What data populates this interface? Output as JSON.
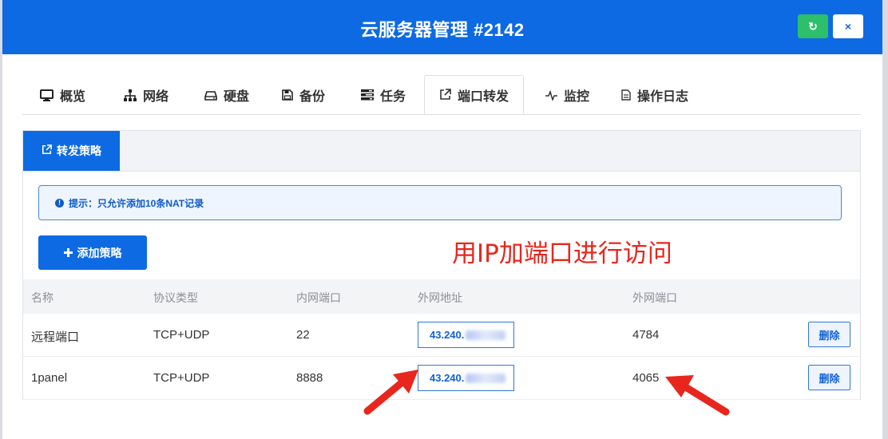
{
  "header": {
    "title": "云服务器管理 #2142",
    "refresh_icon": "refresh-icon",
    "close_icon": "close-icon",
    "close_glyph": "×",
    "refresh_glyph": "↻"
  },
  "tabs": [
    {
      "label": "概览",
      "icon": "monitor-icon"
    },
    {
      "label": "网络",
      "icon": "network-icon"
    },
    {
      "label": "硬盘",
      "icon": "disk-icon"
    },
    {
      "label": "备份",
      "icon": "save-icon"
    },
    {
      "label": "任务",
      "icon": "tasks-icon"
    },
    {
      "label": "端口转发",
      "icon": "external-link-icon",
      "active": true
    },
    {
      "label": "监控",
      "icon": "pulse-icon"
    },
    {
      "label": "操作日志",
      "icon": "file-icon"
    }
  ],
  "subtab": {
    "label": "转发策略",
    "icon": "external-link-icon"
  },
  "alert": {
    "text": "提示：只允许添加10条NAT记录",
    "icon": "info-icon"
  },
  "add_button": {
    "label": "添加策略",
    "icon": "plus-icon"
  },
  "annotation": "用IP加端口进行访问",
  "table": {
    "headers": [
      "名称",
      "协议类型",
      "内网端口",
      "外网地址",
      "外网端口"
    ],
    "rows": [
      {
        "name": "远程端口",
        "protocol": "TCP+UDP",
        "internal_port": "22",
        "external_ip": "43.240.",
        "external_port": "4784",
        "delete": "删除"
      },
      {
        "name": "1panel",
        "protocol": "TCP+UDP",
        "internal_port": "8888",
        "external_ip": "43.240.",
        "external_port": "4065",
        "delete": "删除"
      }
    ]
  },
  "colors": {
    "primary": "#0d6ae3",
    "success": "#2dbf6a",
    "annotation": "#e8261d"
  }
}
